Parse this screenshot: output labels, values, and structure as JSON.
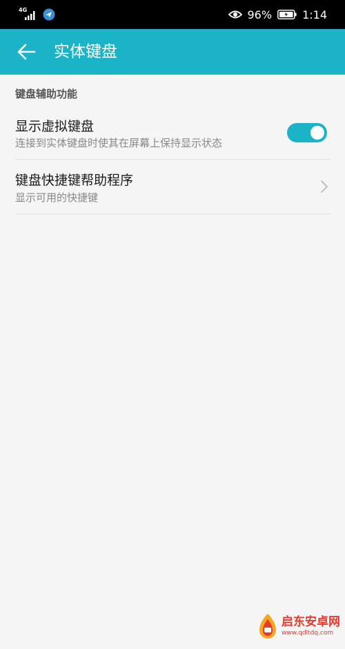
{
  "status_bar": {
    "network_type": "4G",
    "battery_percent": "96%",
    "time": "1:14",
    "icons": [
      "signal-icon",
      "app-notification-icon",
      "eye-icon",
      "battery-icon"
    ]
  },
  "app_bar": {
    "title": "实体键盘",
    "back_icon": "arrow-left-icon",
    "background_color": "#1bb3c8"
  },
  "section": {
    "header": "键盘辅助功能"
  },
  "settings": {
    "show_virtual_keyboard": {
      "title": "显示虚拟键盘",
      "subtitle": "连接到实体键盘时使其在屏幕上保持显示状态",
      "enabled": true
    },
    "shortcut_helper": {
      "title": "键盘快捷键帮助程序",
      "subtitle": "显示可用的快捷键",
      "icon": "chevron-right-icon"
    }
  },
  "watermark": {
    "brand": "启东安卓网",
    "url": "www.qdltdq.com"
  },
  "colors": {
    "accent": "#1bb3c8",
    "status_bar": "#000000",
    "background": "#f5f5f5"
  }
}
